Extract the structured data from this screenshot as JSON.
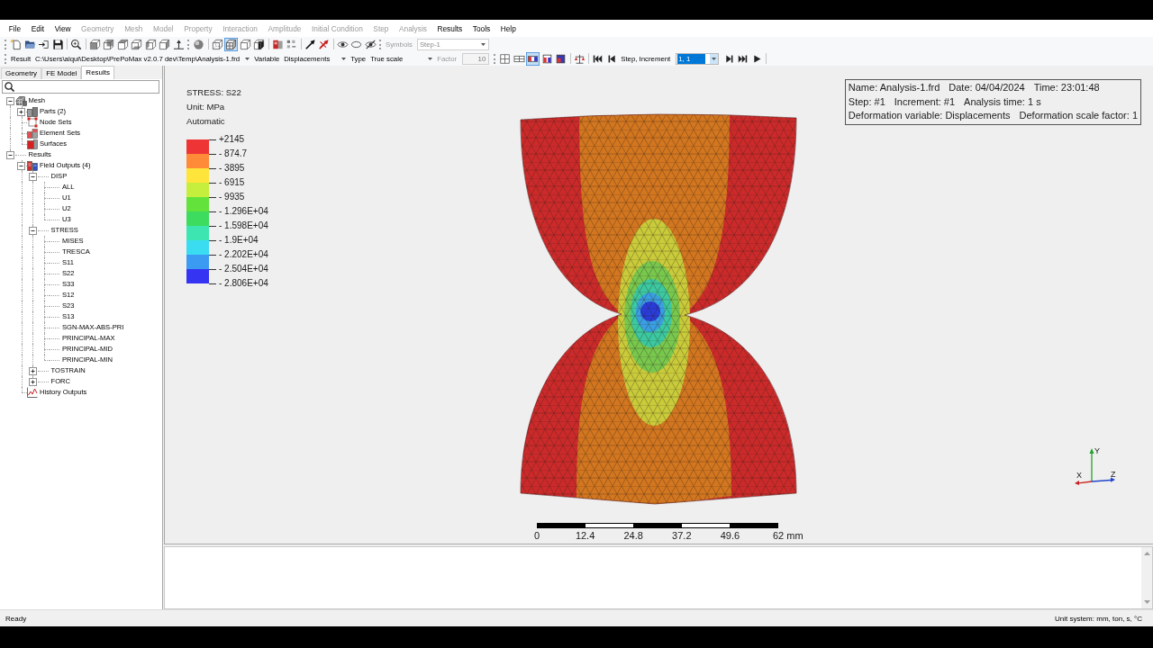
{
  "menu": [
    {
      "label": "File",
      "disabled": false
    },
    {
      "label": "Edit",
      "disabled": false
    },
    {
      "label": "View",
      "disabled": false
    },
    {
      "label": "Geometry",
      "disabled": true
    },
    {
      "label": "Mesh",
      "disabled": true
    },
    {
      "label": "Model",
      "disabled": true
    },
    {
      "label": "Property",
      "disabled": true
    },
    {
      "label": "Interaction",
      "disabled": true
    },
    {
      "label": "Amplitude",
      "disabled": true
    },
    {
      "label": "Initial Condition",
      "disabled": true
    },
    {
      "label": "Step",
      "disabled": true
    },
    {
      "label": "Analysis",
      "disabled": true
    },
    {
      "label": "Results",
      "disabled": false
    },
    {
      "label": "Tools",
      "disabled": false
    },
    {
      "label": "Help",
      "disabled": false
    }
  ],
  "main_toolbar": [
    {
      "kind": "grip"
    },
    {
      "kind": "new"
    },
    {
      "kind": "open"
    },
    {
      "kind": "import"
    },
    {
      "kind": "save"
    },
    {
      "kind": "separator"
    },
    {
      "kind": "zoom"
    },
    {
      "kind": "separator"
    },
    {
      "kind": "front"
    },
    {
      "kind": "back"
    },
    {
      "kind": "top"
    },
    {
      "kind": "bottom"
    },
    {
      "kind": "left"
    },
    {
      "kind": "right"
    },
    {
      "kind": "normal"
    },
    {
      "kind": "grip"
    },
    {
      "kind": "isometric"
    },
    {
      "kind": "separator"
    },
    {
      "kind": "wireframe",
      "pressed": false
    },
    {
      "kind": "edges",
      "pressed": true
    },
    {
      "kind": "shaded",
      "pressed": false
    },
    {
      "kind": "section",
      "pressed": false
    },
    {
      "kind": "separator"
    },
    {
      "kind": "book"
    },
    {
      "kind": "nodes"
    },
    {
      "kind": "separator"
    },
    {
      "kind": "arrow"
    },
    {
      "kind": "noarrow"
    },
    {
      "kind": "separator"
    },
    {
      "kind": "show"
    },
    {
      "kind": "hide"
    },
    {
      "kind": "unhide"
    },
    {
      "kind": "grip"
    },
    {
      "kind": "label",
      "text": "Symbols",
      "disabled": true
    },
    {
      "kind": "combo",
      "value": "Step-1",
      "disabled": true,
      "text_selected": false
    }
  ],
  "results_toolbar": [
    {
      "kind": "grip"
    },
    {
      "kind": "label",
      "text": "Result",
      "disabled": false
    },
    {
      "kind": "combo",
      "value": "C:\\Users\\alqui\\Desktop\\PrePoMax v2.0.7 dev\\Temp\\Analysis-1.frd",
      "disabled": false,
      "text_selected": false
    },
    {
      "kind": "label",
      "text": "Variable",
      "disabled": false
    },
    {
      "kind": "combo",
      "value": "Displacements",
      "disabled": false,
      "text_selected": false
    },
    {
      "kind": "label",
      "text": "Type",
      "disabled": false
    },
    {
      "kind": "combo",
      "value": "True scale",
      "disabled": false,
      "text_selected": false
    },
    {
      "kind": "label",
      "text": "Factor",
      "disabled": true
    },
    {
      "kind": "field",
      "value": "10",
      "disabled": true
    },
    {
      "kind": "grip"
    },
    {
      "kind": "tile4",
      "pressed": false
    },
    {
      "kind": "tile2",
      "pressed": false
    },
    {
      "kind": "bar-a",
      "pressed": true
    },
    {
      "kind": "bar-b",
      "pressed": false
    },
    {
      "kind": "bar-c",
      "pressed": false
    },
    {
      "kind": "separator"
    },
    {
      "kind": "compare"
    },
    {
      "kind": "separator"
    },
    {
      "kind": "first"
    },
    {
      "kind": "previous"
    },
    {
      "kind": "label",
      "text": "Step, Increment",
      "disabled": false
    },
    {
      "kind": "combo",
      "value": "1, 1",
      "disabled": false,
      "text_selected": true
    },
    {
      "kind": "next"
    },
    {
      "kind": "last"
    },
    {
      "kind": "play"
    },
    {
      "kind": "separator"
    }
  ],
  "tabs": [
    {
      "label": "Geometry",
      "selected": false
    },
    {
      "label": "FE Model",
      "selected": false
    },
    {
      "label": "Results",
      "selected": true
    }
  ],
  "tree": [
    {
      "label": "Mesh",
      "kind": "mesh",
      "expanded": true,
      "children": [
        {
          "label": "Parts (2)",
          "kind": "parts",
          "expanded": false
        },
        {
          "label": "Node Sets",
          "kind": "node-sets"
        },
        {
          "label": "Element Sets",
          "kind": "element-sets"
        },
        {
          "label": "Surfaces",
          "kind": "surfaces"
        }
      ]
    },
    {
      "label": "Results",
      "expanded": true,
      "children": [
        {
          "label": "Field Outputs (4)",
          "kind": "field-outputs",
          "expanded": true,
          "children": [
            {
              "label": "DISP",
              "expanded": true,
              "children": [
                {
                  "label": "ALL"
                },
                {
                  "label": "U1"
                },
                {
                  "label": "U2"
                },
                {
                  "label": "U3"
                }
              ]
            },
            {
              "label": "STRESS",
              "expanded": true,
              "children": [
                {
                  "label": "MISES"
                },
                {
                  "label": "TRESCA"
                },
                {
                  "label": "S11"
                },
                {
                  "label": "S22"
                },
                {
                  "label": "S33"
                },
                {
                  "label": "S12"
                },
                {
                  "label": "S23"
                },
                {
                  "label": "S13"
                },
                {
                  "label": "SGN-MAX-ABS-PRI"
                },
                {
                  "label": "PRINCIPAL-MAX"
                },
                {
                  "label": "PRINCIPAL-MID"
                },
                {
                  "label": "PRINCIPAL-MIN"
                }
              ]
            },
            {
              "label": "TOSTRAIN",
              "expanded": false
            },
            {
              "label": "FORC",
              "expanded": false
            }
          ]
        },
        {
          "label": "History Outputs",
          "kind": "history-outputs"
        }
      ]
    }
  ],
  "legend": {
    "title": "STRESS: S22",
    "unit": "Unit: MPa",
    "mode": "Automatic",
    "bands": [
      {
        "color": "#ee3434"
      },
      {
        "color": "#ff8a38"
      },
      {
        "color": "#ffe43c"
      },
      {
        "color": "#c6ee3c"
      },
      {
        "color": "#62e23a"
      },
      {
        "color": "#3ddc5e"
      },
      {
        "color": "#3de6b0"
      },
      {
        "color": "#3adcf2"
      },
      {
        "color": "#3b9af2"
      },
      {
        "color": "#3434f2"
      }
    ],
    "labels": [
      "+2145",
      "- 874.7",
      "- 3895",
      "- 6915",
      "- 9935",
      "- 1.296E+04",
      "- 1.598E+04",
      "- 1.9E+04",
      "- 2.202E+04",
      "- 2.504E+04",
      "- 2.806E+04"
    ]
  },
  "info": [
    [
      "Name: Analysis-1.frd",
      "Date: 04/04/2024",
      "Time: 23:01:48"
    ],
    [
      "Step: #1",
      "Increment: #1",
      "Analysis time: 1 s"
    ],
    [
      "Deformation variable: Displacements",
      "Deformation scale factor: 1"
    ]
  ],
  "scale_bar": [
    "0",
    "12.4",
    "24.8",
    "37.2",
    "49.6",
    "62 mm"
  ],
  "axis_triad": [
    "X",
    "Y",
    "Z"
  ],
  "status_bar": {
    "message": "Ready",
    "units": "Unit system: mm, ton, s, °C"
  }
}
